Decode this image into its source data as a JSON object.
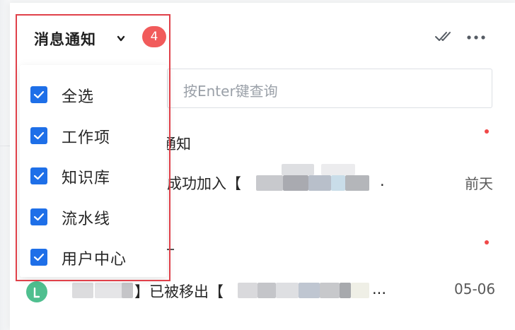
{
  "header": {
    "title": "消息通知",
    "badge": "4",
    "caret_icon": "chevron-down-icon",
    "mark_all_read_icon": "double-check-icon",
    "more_icon": "more-horizontal-icon"
  },
  "search": {
    "placeholder": "按Enter键查询"
  },
  "filter_menu": {
    "items": [
      {
        "label": "全选",
        "checked": true
      },
      {
        "label": "工作项",
        "checked": true
      },
      {
        "label": "知识库",
        "checked": true
      },
      {
        "label": "流水线",
        "checked": true
      },
      {
        "label": "用户中心",
        "checked": true
      }
    ]
  },
  "notifications": [
    {
      "category_fragment": "通知",
      "text_fragment": "成功加入【",
      "ellipsis": ".",
      "time": "前天",
      "unread": true
    },
    {
      "category_fragment": "",
      "text_fragment": "】已被移出【",
      "ellipsis": "...",
      "time": "05-06",
      "unread": true
    }
  ],
  "colors": {
    "accent": "#1e6fe8",
    "badge": "#f15b5b",
    "highlight_frame": "#e0414a",
    "unread_dot": "#f04848",
    "avatar": "#4fbf8f"
  }
}
